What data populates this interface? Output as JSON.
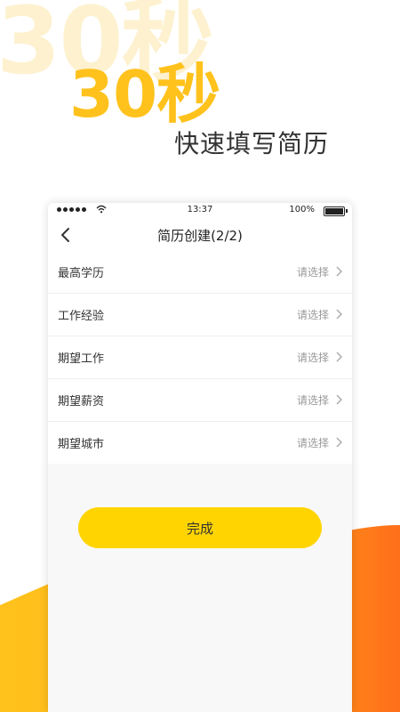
{
  "promo": {
    "watermark": "30秒",
    "title": "30秒",
    "subtitle": "快速填写简历"
  },
  "status_bar": {
    "time": "13:37",
    "battery": "100%"
  },
  "nav": {
    "title": "简历创建(2/2)",
    "back_icon": "chevron-left-icon"
  },
  "form": {
    "rows": [
      {
        "label": "最高学历",
        "value": "请选择"
      },
      {
        "label": "工作经验",
        "value": "请选择"
      },
      {
        "label": "期望工作",
        "value": "请选择"
      },
      {
        "label": "期望薪资",
        "value": "请选择"
      },
      {
        "label": "期望城市",
        "value": "请选择"
      }
    ]
  },
  "actions": {
    "done_label": "完成"
  },
  "colors": {
    "accent_yellow": "#ffd400",
    "title_yellow": "#ffc21c",
    "wave_orange": "#ff7a1c"
  }
}
